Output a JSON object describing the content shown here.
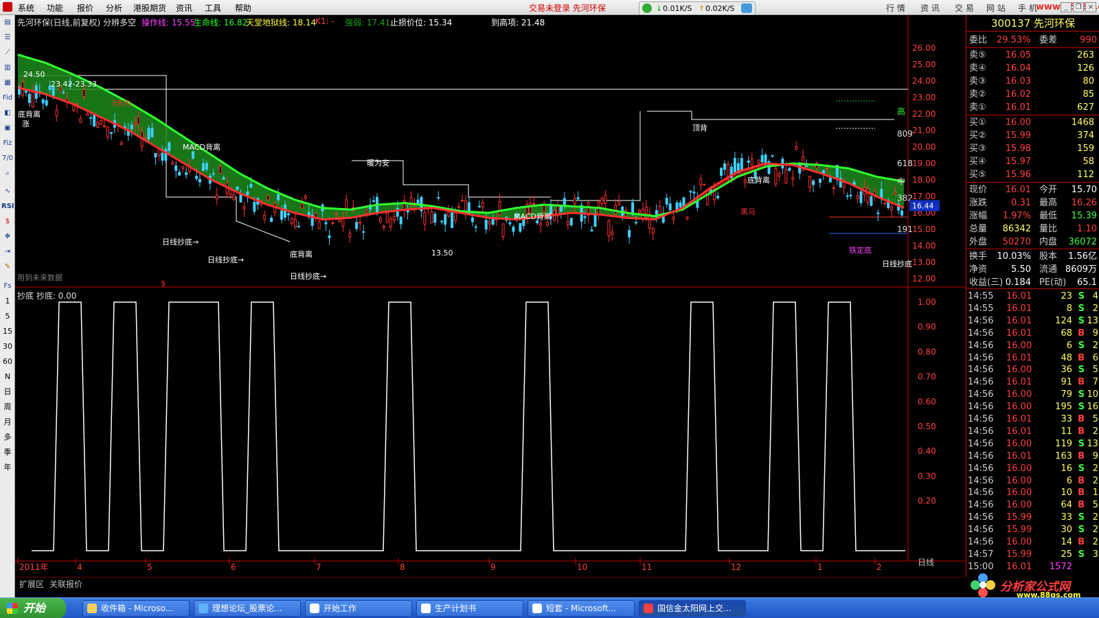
{
  "menu": {
    "items": [
      "系统",
      "功能",
      "报价",
      "分析",
      "港股期货",
      "资讯",
      "工具",
      "帮助"
    ],
    "status": "交易未登录  先河环保",
    "net_down": "0.01K/S",
    "net_up": "0.02K/S",
    "right_tabs": [
      "行 情",
      "资 讯",
      "交 易",
      "网 站",
      "手 机"
    ],
    "watermark": "www.55188.com"
  },
  "left_tools": {
    "icons": [
      "Fid",
      "Fiz",
      "7/0",
      "RSI"
    ],
    "periods": [
      "1",
      "5",
      "15",
      "30",
      "60",
      "N",
      "日",
      "周",
      "月",
      "多",
      "季",
      "年"
    ]
  },
  "legend": {
    "title": "先河环保(日线,前复权) 分辨多空",
    "items": [
      {
        "label": "操作线: 15.55",
        "color": "#ff40ff"
      },
      {
        "label": "生命线: 16.82",
        "color": "#30ff30"
      },
      {
        "label": "天堂地狱线: 18.14",
        "color": "#ffff40"
      },
      {
        "label": "K1: -",
        "color": "#ff4040"
      },
      {
        "label": "强弱: 17.41",
        "color": "#20a020"
      },
      {
        "label": "止损价位: 15.34",
        "color": "#ffffff"
      }
    ],
    "top_note": "到高项: 21.48",
    "future_note": "用到未来数据",
    "sub_title": "抄底  抄底: 0.00"
  },
  "price_axis": [
    "26.00",
    "25.00",
    "24.00",
    "23.00",
    "22.00",
    "21.00",
    "20.00",
    "19.00",
    "18.00",
    "17.00",
    "16.00",
    "15.00",
    "14.00",
    "13.00",
    "12.00"
  ],
  "price_axis_range": [
    12,
    26
  ],
  "sub_axis": [
    "1.00",
    "0.90",
    "0.80",
    "0.70",
    "0.60",
    "0.50",
    "0.40",
    "0.30",
    "0.20"
  ],
  "right_marks": [
    {
      "text": "高",
      "value": 22.15
    },
    {
      "text": "809",
      "value": 20.8
    },
    {
      "text": "618",
      "value": 19.0
    },
    {
      "text": "中",
      "value": 17.9
    },
    {
      "text": "382",
      "value": 16.9
    },
    {
      "text": "191",
      "value": 15.0
    }
  ],
  "current_price_label": "16.44",
  "current_price_value": 16.44,
  "annotations": [
    {
      "text": "24.50",
      "color": "#ffffff"
    },
    {
      "text": "23.42-23.33",
      "color": "#ffffff"
    },
    {
      "text": "底背离",
      "color": "#ffffff"
    },
    {
      "text": "涨",
      "color": "#ffffff"
    },
    {
      "text": "3天内",
      "color": "#ff3030"
    },
    {
      "text": "MACD背离",
      "color": "#ffffff"
    },
    {
      "text": "日线抄底→",
      "color": "#ffffff"
    },
    {
      "text": "日线抄底→",
      "color": "#ffffff"
    },
    {
      "text": "日线抄底→",
      "color": "#ffffff"
    },
    {
      "text": "底背离",
      "color": "#ffffff"
    },
    {
      "text": "13.50",
      "color": "#ffffff"
    },
    {
      "text": "暖为安",
      "color": "#ffffff"
    },
    {
      "text": "MACD背离",
      "color": "#ffffff"
    },
    {
      "text": "顶背",
      "color": "#ffffff"
    },
    {
      "text": "底背离",
      "color": "#ffffff"
    },
    {
      "text": "黑马",
      "color": "#ff3030"
    },
    {
      "text": "铁定底",
      "color": "#ff40ff"
    },
    {
      "text": "日线抄底",
      "color": "#ffffff"
    },
    {
      "text": "$",
      "color": "#ff3030"
    }
  ],
  "time_axis": [
    "2011年",
    "4",
    "5",
    "6",
    "7",
    "8",
    "9",
    "10",
    "11",
    "12",
    "1",
    "2"
  ],
  "time_axis_right": "日线",
  "bottom_tabs": [
    "扩展区",
    "关联报价"
  ],
  "chart_data": [
    {
      "type": "line",
      "title": "先河环保(日线,前复权) 分辨多空",
      "ylim": [
        12,
        26
      ],
      "series": [
        {
          "name": "生命线",
          "color": "#30ff30",
          "values": [
            25.6,
            25.1,
            24.4,
            23.6,
            22.7,
            21.7,
            20.6,
            19.5,
            18.4,
            17.5,
            16.8,
            16.3,
            16.2,
            16.5,
            16.6,
            16.4,
            16.1,
            16.0,
            16.3,
            16.5,
            16.4,
            16.3,
            16.0,
            15.8,
            16.2,
            17.2,
            18.2,
            18.8,
            19.0,
            18.9,
            18.7,
            18.2,
            17.9
          ]
        },
        {
          "name": "操作线",
          "color": "#ff40ff",
          "values": [
            23.6,
            23.2,
            22.6,
            21.8,
            21.0,
            20.0,
            19.0,
            18.0,
            17.2,
            16.5,
            16.0,
            15.6,
            15.7,
            16.0,
            16.2,
            16.3,
            16.0,
            15.7,
            15.6,
            15.8,
            16.0,
            15.9,
            15.7,
            15.6,
            16.3,
            17.5,
            18.5,
            19.0,
            18.9,
            18.4,
            17.8,
            17.0,
            16.3
          ]
        }
      ]
    },
    {
      "type": "line",
      "title": "抄底  抄底: 0.00",
      "ylim": [
        0,
        1
      ],
      "series": [
        {
          "name": "抄底",
          "color": "#ffffff",
          "values": [
            0,
            1,
            0,
            1,
            0,
            1,
            1,
            0,
            1,
            0,
            0,
            0,
            0,
            1,
            0,
            0,
            0,
            0,
            1,
            0,
            0,
            0,
            0,
            0,
            1,
            0,
            0,
            1,
            0,
            1,
            0,
            0
          ]
        }
      ]
    }
  ],
  "quote": {
    "header": "300137 先河环保",
    "weibi_label": "委比",
    "weibi_value": "29.53%",
    "weicha_label": "委差",
    "weicha_value": "990",
    "asks": [
      {
        "label": "卖⑤",
        "price": "16.05",
        "vol": "263"
      },
      {
        "label": "卖④",
        "price": "16.04",
        "vol": "126"
      },
      {
        "label": "卖③",
        "price": "16.03",
        "vol": "80"
      },
      {
        "label": "卖②",
        "price": "16.02",
        "vol": "85"
      },
      {
        "label": "卖①",
        "price": "16.01",
        "vol": "627"
      }
    ],
    "bids": [
      {
        "label": "买①",
        "price": "16.00",
        "vol": "1468"
      },
      {
        "label": "买②",
        "price": "15.99",
        "vol": "374"
      },
      {
        "label": "买③",
        "price": "15.98",
        "vol": "159"
      },
      {
        "label": "买④",
        "price": "15.97",
        "vol": "58"
      },
      {
        "label": "买⑤",
        "price": "15.96",
        "vol": "112"
      }
    ],
    "stats": [
      {
        "l1": "现价",
        "v1": "16.01",
        "c1": "#ff4040",
        "l2": "今开",
        "v2": "15.70",
        "c2": "#ffffff"
      },
      {
        "l1": "涨跌",
        "v1": "0.31",
        "c1": "#ff4040",
        "l2": "最高",
        "v2": "16.26",
        "c2": "#ff4040"
      },
      {
        "l1": "涨幅",
        "v1": "1.97%",
        "c1": "#ff4040",
        "l2": "最低",
        "v2": "15.39",
        "c2": "#40ff40"
      },
      {
        "l1": "总量",
        "v1": "86342",
        "c1": "#ffff60",
        "l2": "量比",
        "v2": "1.10",
        "c2": "#ff4040"
      },
      {
        "l1": "外盘",
        "v1": "50270",
        "c1": "#ff4040",
        "l2": "内盘",
        "v2": "36072",
        "c2": "#40ff40"
      }
    ],
    "stats2": [
      {
        "l1": "换手",
        "v1": "10.03%",
        "l2": "股本",
        "v2": "1.56亿"
      },
      {
        "l1": "净资",
        "v1": "5.50",
        "l2": "流通",
        "v2": "8609万"
      },
      {
        "l1": "收益(三)",
        "v1": "0.184",
        "l2": "PE(动)",
        "v2": "65.1"
      }
    ],
    "ticks": [
      {
        "t": "14:55",
        "p": "16.01",
        "v": "23",
        "s": "S",
        "n": "4"
      },
      {
        "t": "14:55",
        "p": "16.01",
        "v": "8",
        "s": "S",
        "n": "2"
      },
      {
        "t": "14:56",
        "p": "16.01",
        "v": "124",
        "s": "S",
        "n": "13"
      },
      {
        "t": "14:56",
        "p": "16.01",
        "v": "68",
        "s": "B",
        "n": "9"
      },
      {
        "t": "14:56",
        "p": "16.00",
        "v": "6",
        "s": "S",
        "n": "2"
      },
      {
        "t": "14:56",
        "p": "16.01",
        "v": "48",
        "s": "B",
        "n": "6"
      },
      {
        "t": "14:56",
        "p": "16.00",
        "v": "36",
        "s": "S",
        "n": "5"
      },
      {
        "t": "14:56",
        "p": "16.01",
        "v": "91",
        "s": "B",
        "n": "7"
      },
      {
        "t": "14:56",
        "p": "16.00",
        "v": "79",
        "s": "S",
        "n": "10"
      },
      {
        "t": "14:56",
        "p": "16.00",
        "v": "195",
        "s": "S",
        "n": "16"
      },
      {
        "t": "14:56",
        "p": "16.01",
        "v": "33",
        "s": "B",
        "n": "5"
      },
      {
        "t": "14:56",
        "p": "16.01",
        "v": "11",
        "s": "B",
        "n": "2"
      },
      {
        "t": "14:56",
        "p": "16.00",
        "v": "119",
        "s": "S",
        "n": "13"
      },
      {
        "t": "14:56",
        "p": "16.01",
        "v": "163",
        "s": "B",
        "n": "9"
      },
      {
        "t": "14:56",
        "p": "16.00",
        "v": "16",
        "s": "S",
        "n": "2"
      },
      {
        "t": "14:56",
        "p": "16.00",
        "v": "6",
        "s": "B",
        "n": "2"
      },
      {
        "t": "14:56",
        "p": "16.00",
        "v": "10",
        "s": "B",
        "n": "1"
      },
      {
        "t": "14:56",
        "p": "16.00",
        "v": "64",
        "s": "B",
        "n": "5"
      },
      {
        "t": "14:56",
        "p": "15.99",
        "v": "33",
        "s": "S",
        "n": "2"
      },
      {
        "t": "14:56",
        "p": "15.99",
        "v": "30",
        "s": "S",
        "n": "2"
      },
      {
        "t": "14:56",
        "p": "16.00",
        "v": "14",
        "s": "B",
        "n": "2"
      },
      {
        "t": "14:57",
        "p": "15.99",
        "v": "25",
        "s": "S",
        "n": "3"
      },
      {
        "t": "15:00",
        "p": "16.01",
        "v": "1572",
        "s": "",
        "n": ""
      }
    ]
  },
  "brand": {
    "name": "分析家公式网",
    "url": "www.88gs.com"
  },
  "taskbar": {
    "start": "开始",
    "tasks": [
      "收件箱 - Microso...",
      "理想论坛_股票论...",
      "开始工作",
      "生产计划书",
      "短套 - Microsoft...",
      "国信金太阳网上交..."
    ]
  }
}
